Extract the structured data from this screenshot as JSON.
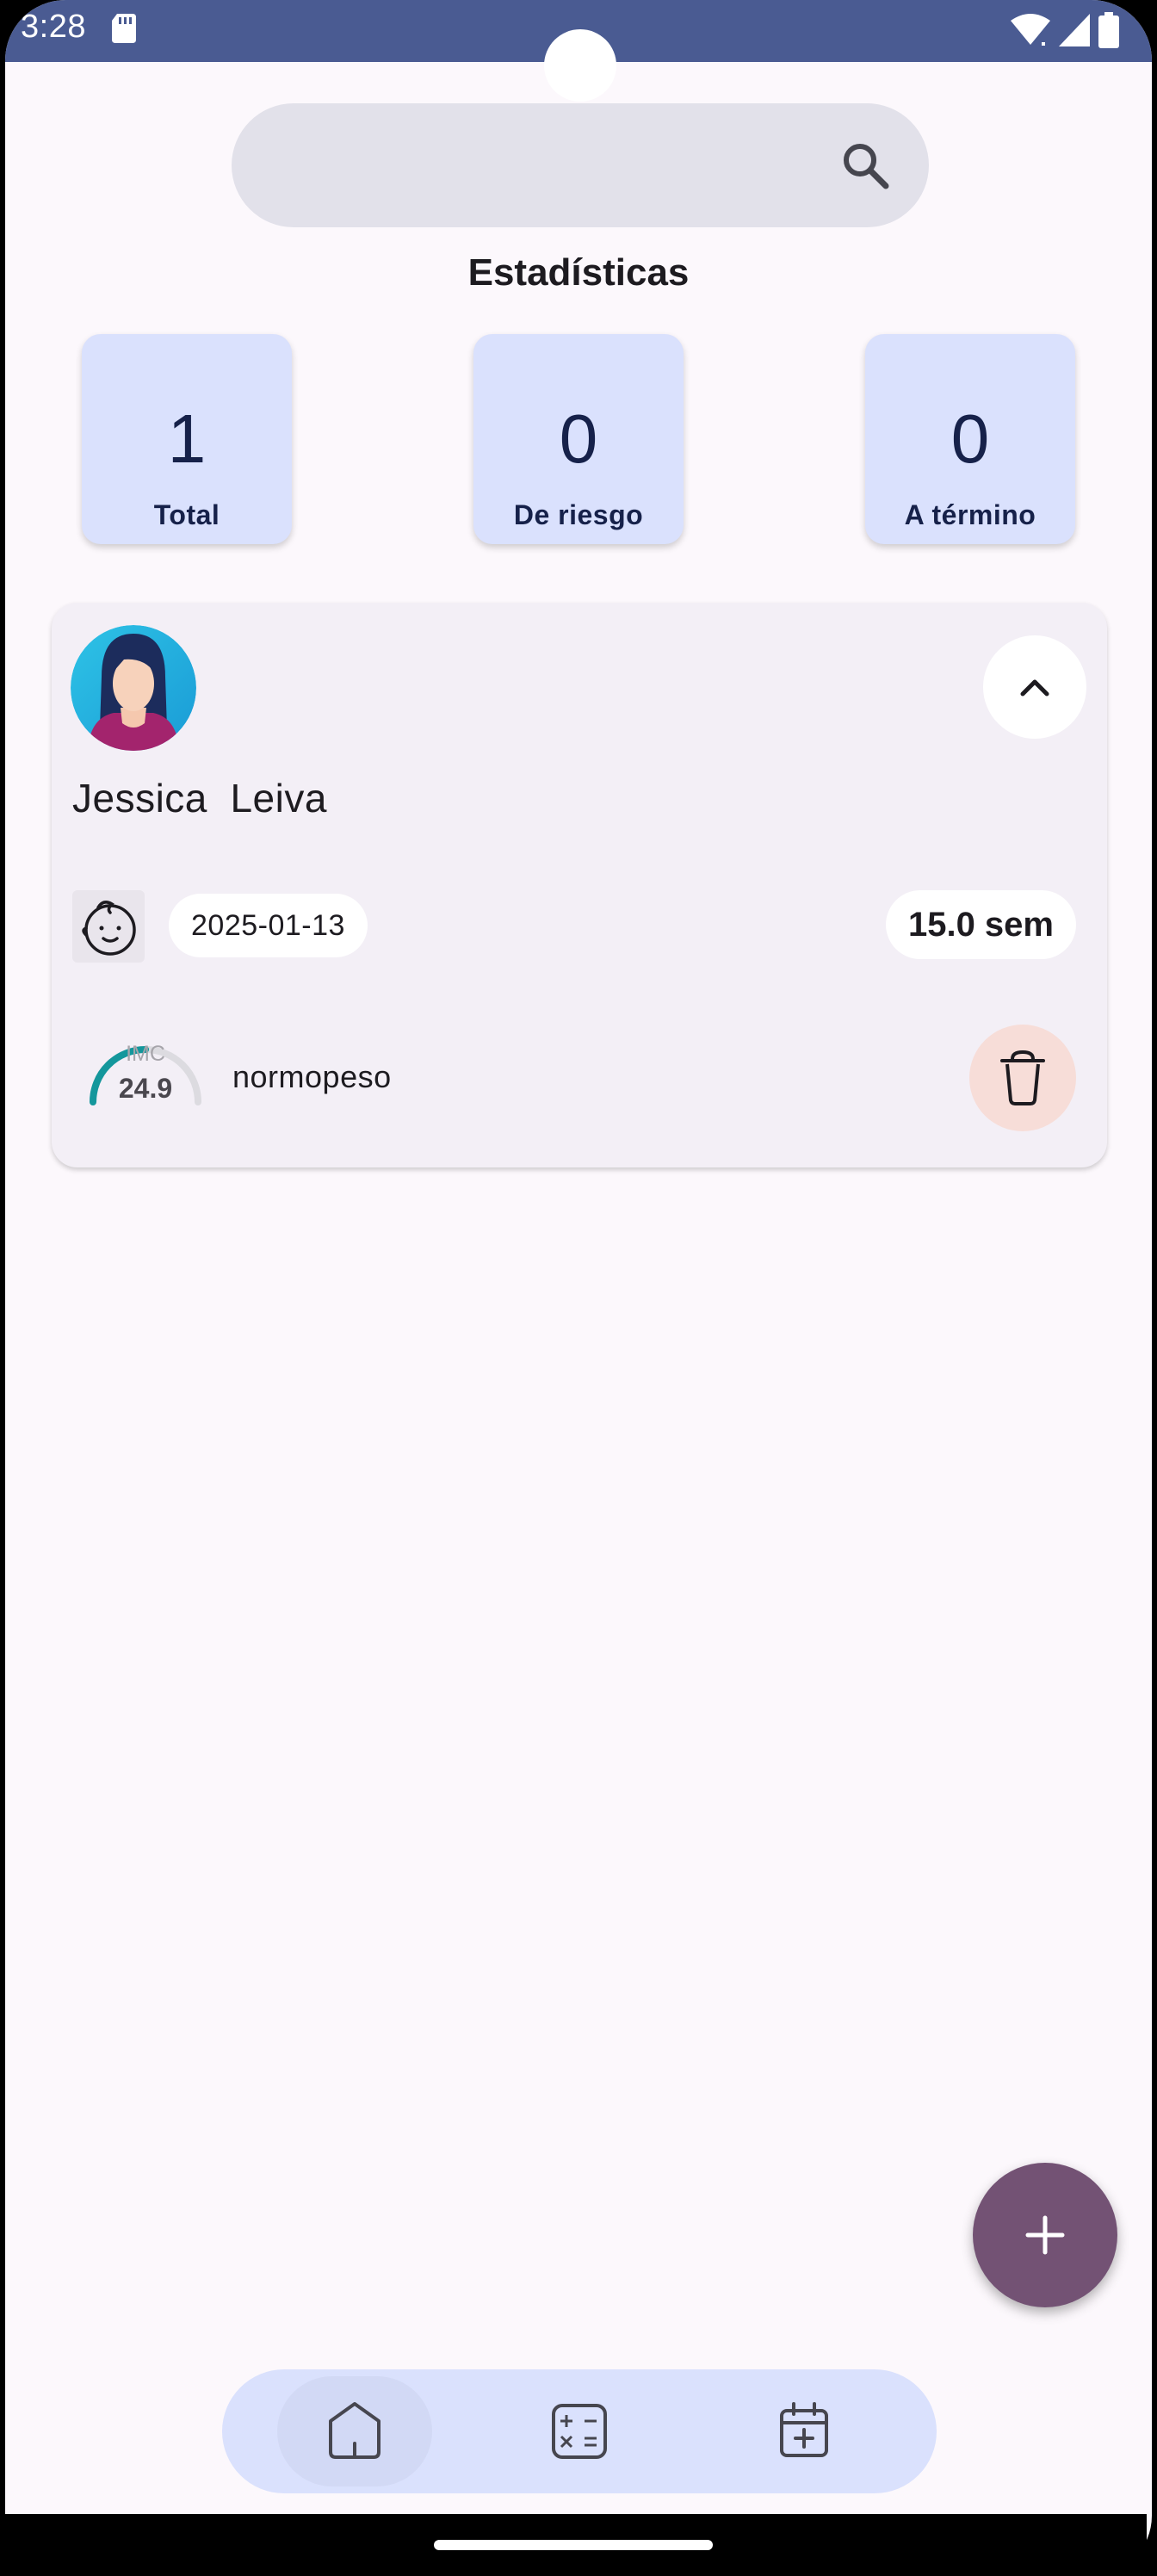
{
  "status_bar": {
    "time": "3:28",
    "icons": [
      "sd-card-icon",
      "wifi-icon",
      "cell-signal-icon",
      "battery-icon"
    ]
  },
  "search": {
    "placeholder": "",
    "icon": "search-icon"
  },
  "stats": {
    "title": "Estadísticas",
    "cards": [
      {
        "value": "1",
        "label": "Total"
      },
      {
        "value": "0",
        "label": "De riesgo"
      },
      {
        "value": "0",
        "label": "A término"
      }
    ]
  },
  "patient": {
    "name": "Jessica  Leiva",
    "date": "2025-01-13",
    "weeks": "15.0 sem",
    "imc_label": "IMC",
    "imc_value": "24.9",
    "imc_fraction": 0.5,
    "imc_status": "normopeso"
  },
  "colors": {
    "status_bar": "#4a5b92",
    "accent": "#735274",
    "stat_card_bg": "#dae1fd",
    "gauge": "#14979c",
    "delete_bg": "#f7ddd8"
  },
  "nav": {
    "items": [
      {
        "icon": "home-icon",
        "active": true
      },
      {
        "icon": "calculator-icon",
        "active": false
      },
      {
        "icon": "calendar-add-icon",
        "active": false
      }
    ]
  }
}
